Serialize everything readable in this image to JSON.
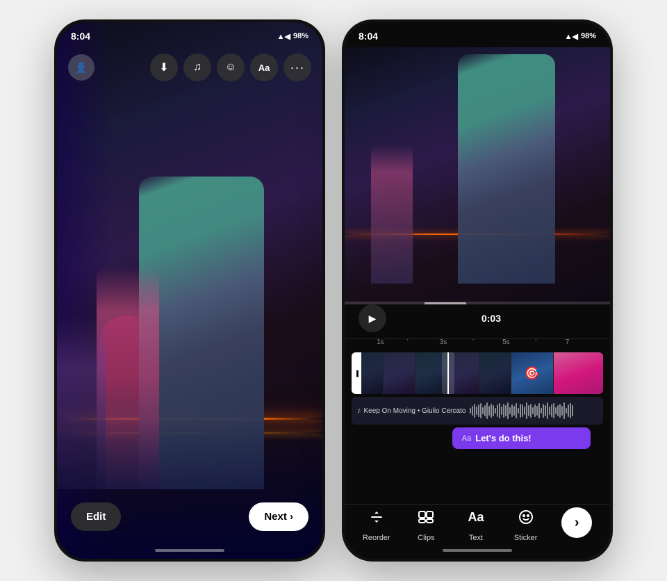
{
  "page": {
    "background": "#f0f0f0"
  },
  "phone1": {
    "status": {
      "time": "8:04",
      "battery": "98%",
      "signal": "▲◀",
      "wifi": "◀"
    },
    "toolbar": {
      "save_icon": "⬇",
      "music_icon": "♫",
      "emoji_icon": "☺",
      "text_icon": "Aa",
      "more_icon": "•••"
    },
    "bottom": {
      "edit_label": "Edit",
      "next_label": "Next ›"
    }
  },
  "phone2": {
    "status": {
      "time": "8:04",
      "battery": "98%"
    },
    "playback": {
      "time": "0:03"
    },
    "timeline": {
      "marks": [
        "1s",
        "3s",
        "5s",
        "7"
      ]
    },
    "audio": {
      "icon": "♪",
      "label": "Keep On Moving • Giulio Cercato"
    },
    "text_track": {
      "icon": "Aa",
      "label": "Let's do this!"
    },
    "toolbar": {
      "reorder_icon": "↺",
      "reorder_label": "Reorder",
      "clips_icon": "⊞",
      "clips_label": "Clips",
      "text_icon": "Aa",
      "text_label": "Text",
      "sticker_icon": "☺",
      "sticker_label": "Sticker",
      "next_icon": "›"
    }
  }
}
